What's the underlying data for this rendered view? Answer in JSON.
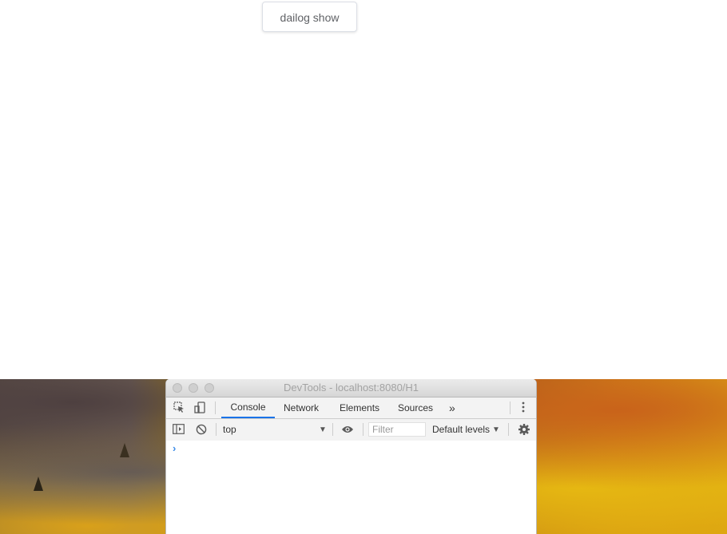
{
  "page": {
    "button_label": "dailog show"
  },
  "devtools": {
    "window_title": "DevTools - localhost:8080/H1",
    "tabs": [
      "Console",
      "Network",
      "Elements",
      "Sources"
    ],
    "active_tab": "Console",
    "more_tabs_icon": "»",
    "context_select": "top",
    "filter_placeholder": "Filter",
    "levels_select": "Default levels",
    "console_prompt": "›",
    "icons": {
      "inspect": "inspect-element-icon",
      "device": "device-toolbar-icon",
      "sidebar": "console-sidebar-icon",
      "clear": "clear-console-icon",
      "eye": "live-expression-icon",
      "settings": "gear-icon",
      "menu": "kebab-menu-icon"
    },
    "accent_color": "#1a73e8"
  }
}
